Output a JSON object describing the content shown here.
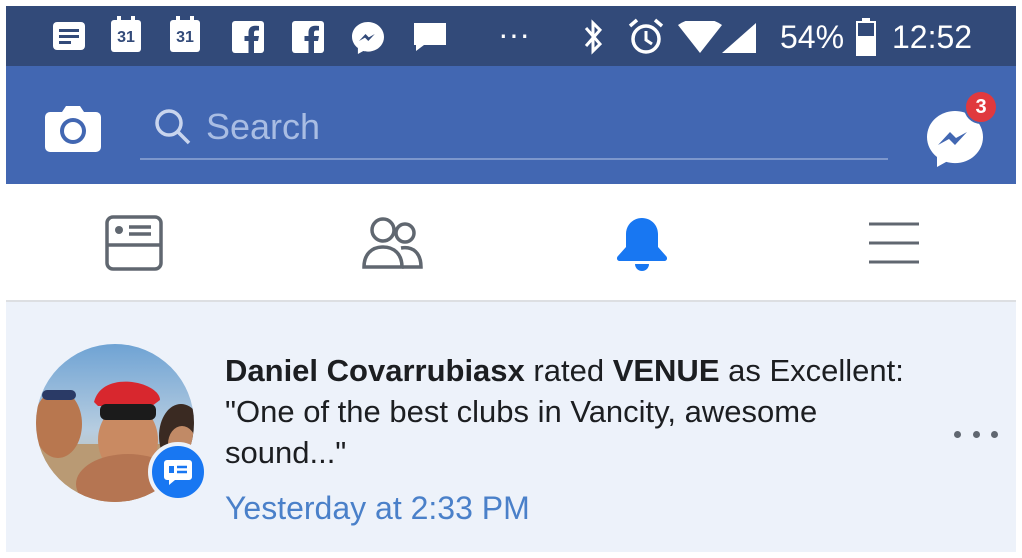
{
  "status_bar": {
    "calendar_day_1": "31",
    "calendar_day_2": "31",
    "overflow": "···",
    "battery": "54%",
    "time": "12:52"
  },
  "header": {
    "search_placeholder": "Search",
    "messenger_badge_count": "3"
  },
  "tabs": [
    {
      "name": "news-feed",
      "icon": "news-feed-icon",
      "active": false
    },
    {
      "name": "friends",
      "icon": "friends-icon",
      "active": false
    },
    {
      "name": "notifications",
      "icon": "bell-icon",
      "active": true
    },
    {
      "name": "menu",
      "icon": "hamburger-menu-icon",
      "active": false
    }
  ],
  "notification": {
    "actor": "Daniel Covarrubiasx",
    "verb": " rated ",
    "target": "VENUE",
    "rest": " as Excellent: \"One of the best clubs in Vancity, awesome sound...\"",
    "time": "Yesterday at 2:33 PM"
  },
  "colors": {
    "status_bar": "#324a79",
    "header": "#4267b2",
    "active_tab": "#1877f2",
    "unread_bg": "#edf2fa",
    "time_link": "#4a80c9",
    "badge": "#e0393e"
  }
}
